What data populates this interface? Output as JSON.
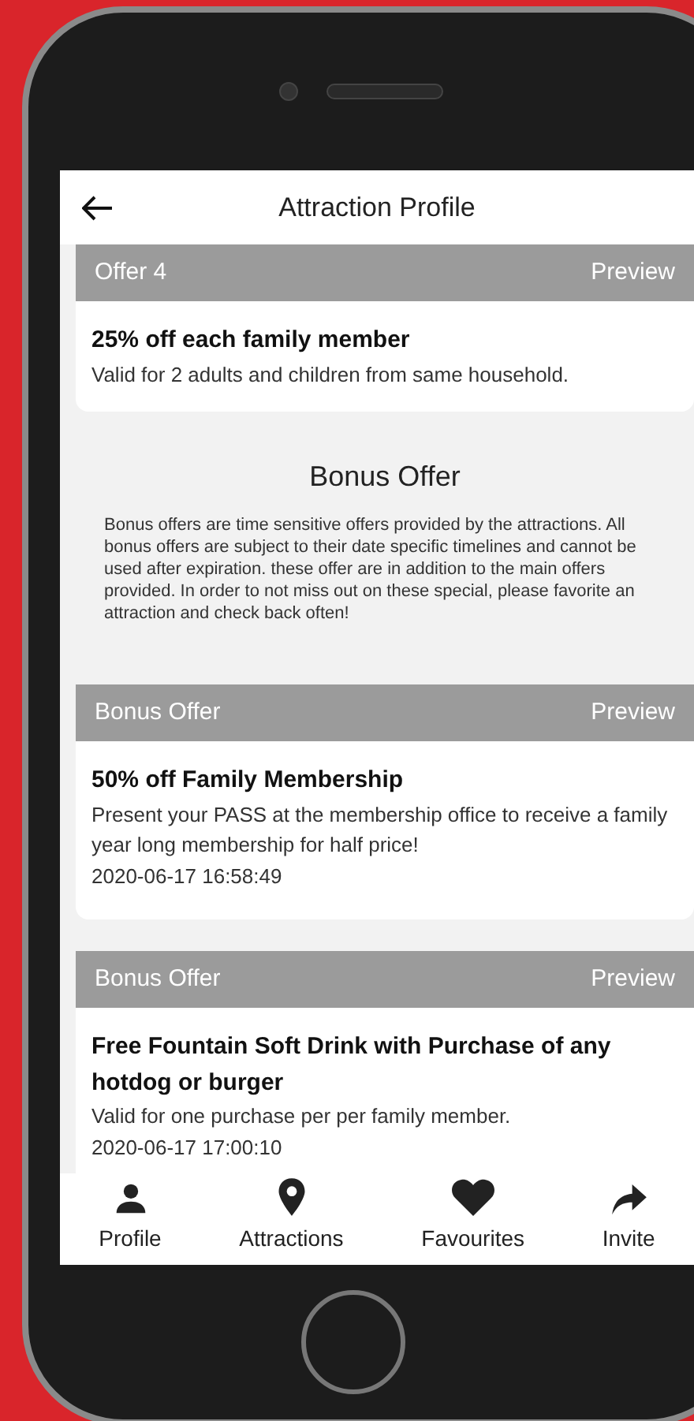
{
  "header": {
    "title": "Attraction Profile"
  },
  "top_offer": {
    "label": "Offer 4",
    "action": "Preview",
    "title": "25% off each family member",
    "description": "Valid for 2 adults and children from same household."
  },
  "bonus_info": {
    "heading": "Bonus Offer",
    "text": "Bonus offers are time sensitive offers provided by the attractions. All bonus offers are subject to their date specific timelines and cannot be used after expiration. these offer are in addition to the main offers provided. In order to not miss out on these special, please favorite an attraction and check back often!"
  },
  "bonus_offers": [
    {
      "label": "Bonus Offer",
      "action": "Preview",
      "title": "50% off Family Membership",
      "description": "Present your PASS at the membership office to receive a family year long membership for half price!",
      "date": "2020-06-17 16:58:49"
    },
    {
      "label": "Bonus Offer",
      "action": "Preview",
      "title": "Free Fountain Soft Drink with Purchase of any hotdog or burger",
      "description": "Valid for one purchase per per family member.",
      "date": "2020-06-17 17:00:10"
    }
  ],
  "tab_bar": [
    {
      "label": "Profile"
    },
    {
      "label": "Attractions"
    },
    {
      "label": "Favourites"
    },
    {
      "label": "Invite"
    }
  ]
}
